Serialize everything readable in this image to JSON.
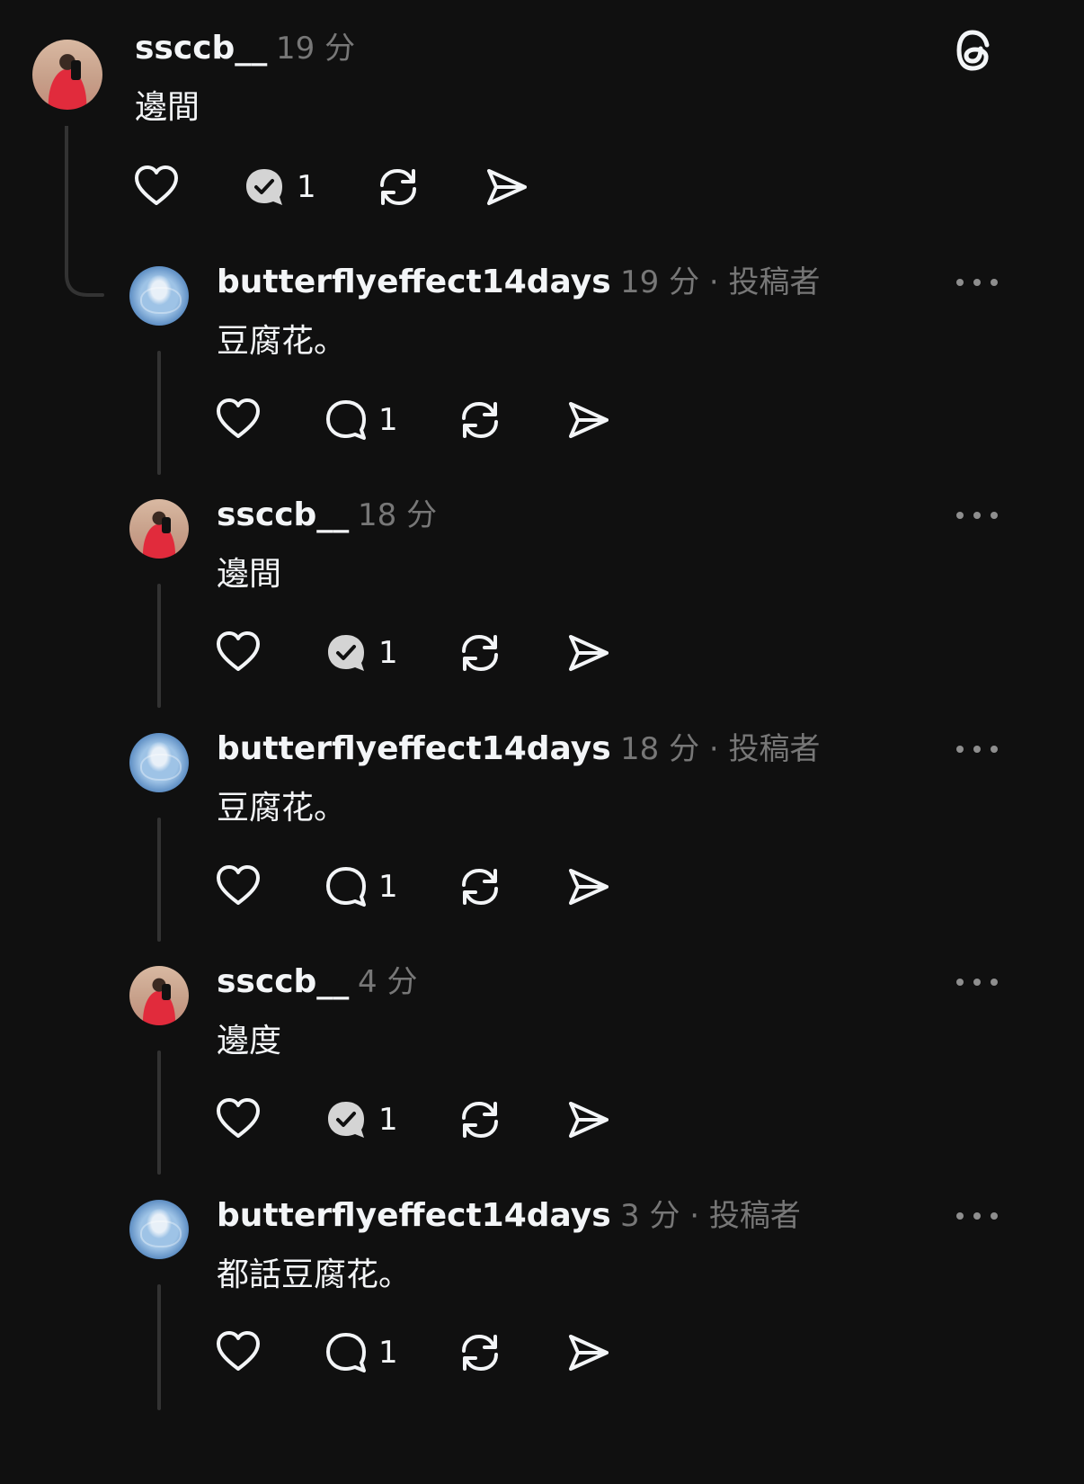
{
  "app": {
    "logo_icon": "threads-logo-icon"
  },
  "posts": [
    {
      "username": "ssccb__",
      "time": "19 分",
      "author_tag": "",
      "text": "邊間",
      "reply_count": "1",
      "replied_by_author": true
    },
    {
      "username": "butterflyeffect14days",
      "time": "19 分",
      "author_tag": "· 投稿者",
      "text": "豆腐花。",
      "reply_count": "1",
      "replied_by_author": false
    },
    {
      "username": "ssccb__",
      "time": "18 分",
      "author_tag": "",
      "text": "邊間",
      "reply_count": "1",
      "replied_by_author": true
    },
    {
      "username": "butterflyeffect14days",
      "time": "18 分",
      "author_tag": "· 投稿者",
      "text": "豆腐花。",
      "reply_count": "1",
      "replied_by_author": false
    },
    {
      "username": "ssccb__",
      "time": "4 分",
      "author_tag": "",
      "text": "邊度",
      "reply_count": "1",
      "replied_by_author": true
    },
    {
      "username": "butterflyeffect14days",
      "time": "3 分",
      "author_tag": "· 投稿者",
      "text": "都話豆腐花。",
      "reply_count": "1",
      "replied_by_author": false
    }
  ],
  "icons": {
    "like": "heart-icon",
    "reply": "comment-icon",
    "reply_checked": "comment-checked-icon",
    "repost": "repost-icon",
    "share": "send-icon",
    "more": "more-icon"
  }
}
